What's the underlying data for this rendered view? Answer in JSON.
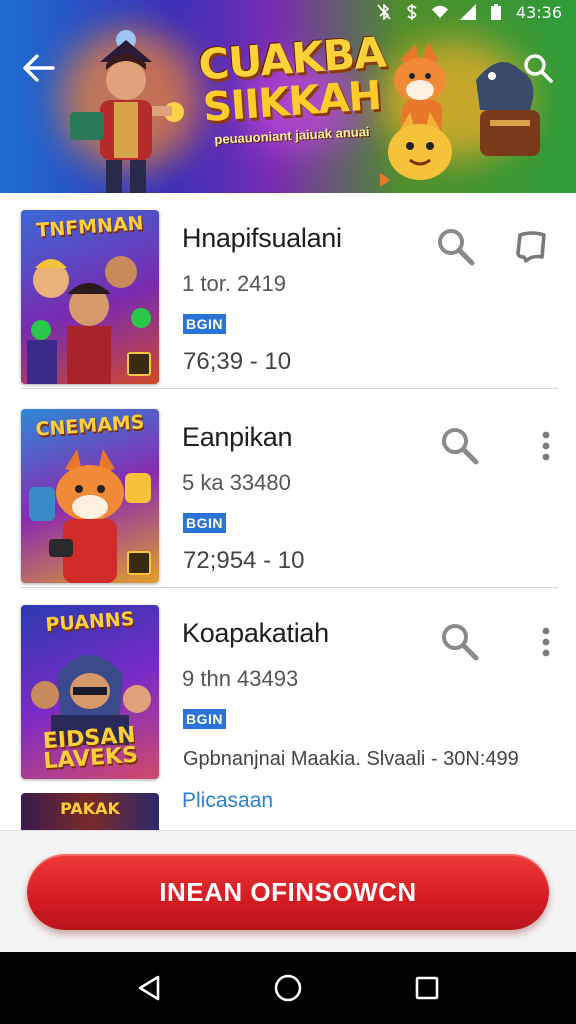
{
  "status_bar": {
    "time": "43:36",
    "icons": [
      "bluetooth-off-icon",
      "currency-icon",
      "wifi-icon",
      "signal-icon",
      "battery-icon"
    ]
  },
  "header": {
    "back_icon": "arrow-left-icon",
    "search_icon": "search-icon",
    "banner_title_line1": "CUAKBA",
    "banner_title_line2": "SIIKKAH",
    "banner_tagline": "peuauoniant jaiuak anuai"
  },
  "items": [
    {
      "thumb_title": "TNFMNAN",
      "title": "Hnapifsualani",
      "subtitle": "1 tor. 2419",
      "badge": "BGIN",
      "meta": "76;39  - 10",
      "action_icon": "search-icon",
      "secondary_icon": "bookmark-icon"
    },
    {
      "thumb_title": "CNEMAMS",
      "title": "Eanpikan",
      "subtitle": "5 ka 33480",
      "badge": "BGIN",
      "meta": "72;954 - 10",
      "action_icon": "search-icon",
      "secondary_icon": "more-vert-icon"
    },
    {
      "thumb_title": "PUANNS",
      "thumb_title_bottom": "EIDSAN LAVEKS",
      "title": "Koapakatiah",
      "subtitle": "9 thn 43493",
      "badge": "BGIN",
      "meta": "Gpbnanjnai Maakia. Slvaali - 30N:499",
      "action_icon": "search-icon",
      "secondary_icon": "more-vert-icon"
    }
  ],
  "partial_item": {
    "link_text": "Plicasaan",
    "thumb_title": "PAKAK"
  },
  "cta": {
    "label": "INEAN OFINSOWCN"
  },
  "nav_bar": {
    "back_icon": "triangle-back-icon",
    "home_icon": "circle-home-icon",
    "recents_icon": "square-recents-icon"
  },
  "colors": {
    "accent_red": "#d41c22",
    "badge_blue": "#2a73d8",
    "link_blue": "#2a7fd4",
    "navbar": "#000000"
  }
}
